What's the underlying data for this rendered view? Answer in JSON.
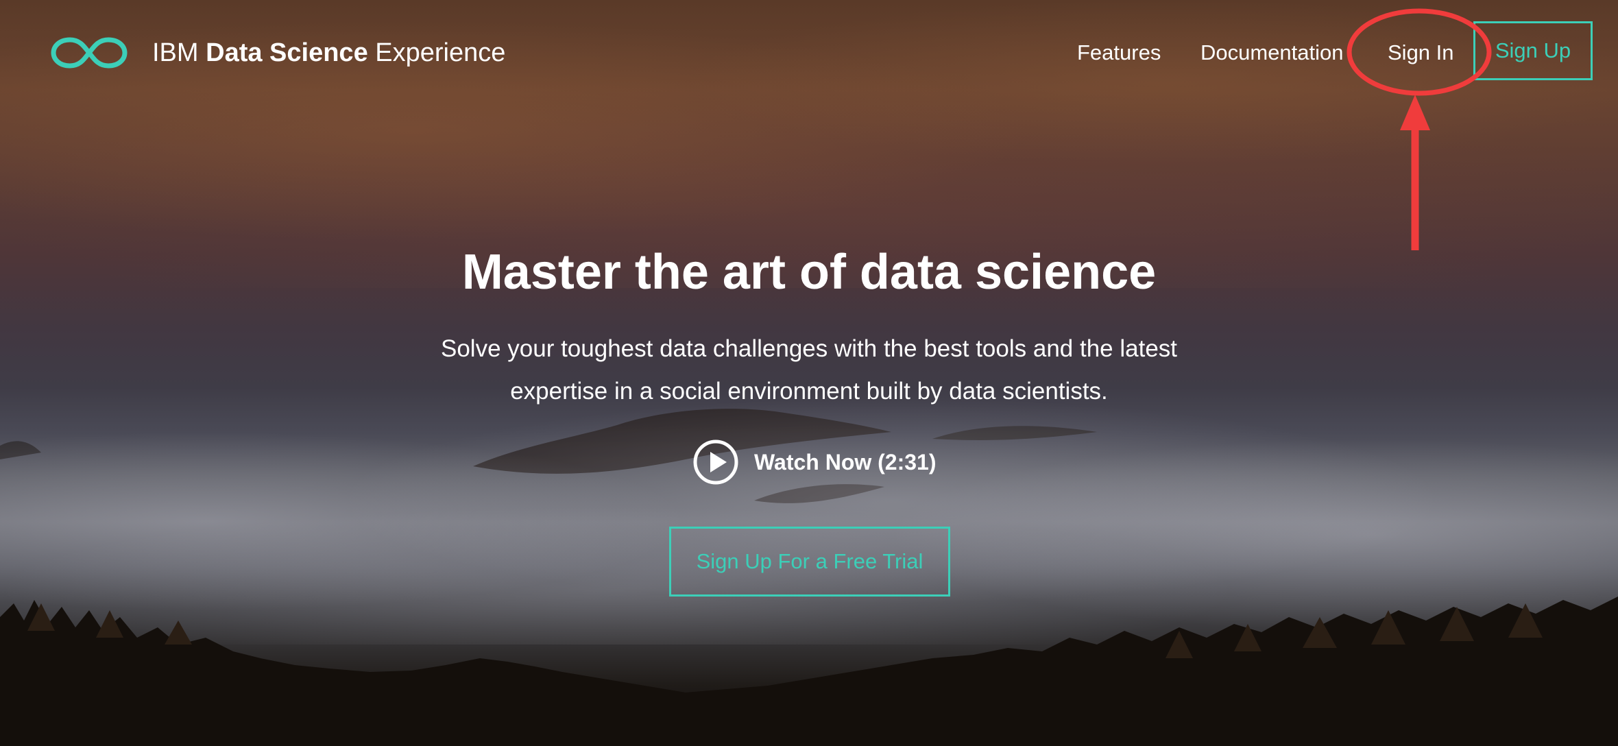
{
  "brand": {
    "prefix": "IBM",
    "bold": "Data Science",
    "suffix": "Experience",
    "logo_icon": "infinity-icon"
  },
  "nav": {
    "features": "Features",
    "documentation": "Documentation",
    "sign_in": "Sign In",
    "sign_up": "Sign Up"
  },
  "hero": {
    "title": "Master the art of data science",
    "subtitle_line1": "Solve your toughest data challenges with the best tools and the latest",
    "subtitle_line2": "expertise in a social environment built by data scientists.",
    "watch_label": "Watch Now (2:31)",
    "watch_icon": "play-circle-icon",
    "cta": "Sign Up For a Free Trial"
  },
  "colors": {
    "accent": "#3ccfb8",
    "annotation": "#f03c3c",
    "text": "#ffffff"
  }
}
